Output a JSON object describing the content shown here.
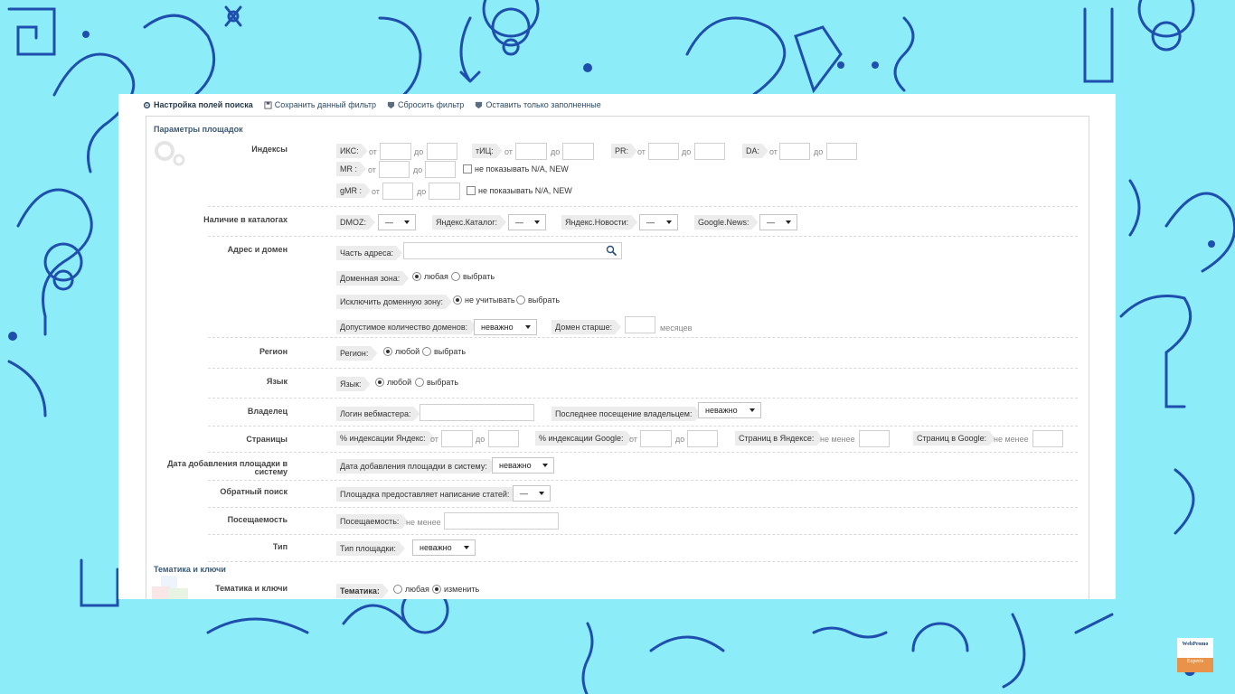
{
  "toolbar": {
    "items": [
      {
        "label": "Настройка полей поиска",
        "icon": "gear-icon"
      },
      {
        "label": "Сохранить данный фильтр",
        "icon": "save-icon"
      },
      {
        "label": "Сбросить фильтр",
        "icon": "shield-icon"
      },
      {
        "label": "Оставить только заполненные",
        "icon": "shield-icon"
      }
    ]
  },
  "sections": {
    "params_title": "Параметры площадок",
    "topics_title": "Тематика и ключи"
  },
  "indexes": {
    "label": "Индексы",
    "iks": "ИКС:",
    "tic": "тИЦ:",
    "pr": "PR:",
    "da": "DA:",
    "mr": "MR :",
    "gmr": "gMR :",
    "from": "от",
    "to": "до",
    "hide_na": "не показывать N/A, NEW"
  },
  "catalogs": {
    "label": "Наличие в каталогах",
    "dmoz": "DMOZ:",
    "yandex_catalog": "Яндекс.Каталог:",
    "yandex_news": "Яндекс.Новости:",
    "google_news": "Google.News:",
    "dash": "—"
  },
  "address": {
    "label": "Адрес и домен",
    "part": "Часть адреса:",
    "zone": "Доменная зона:",
    "exclude_zone": "Исключить доменную зону:",
    "domains_count": "Допустимое количество доменов:",
    "domains_count_value": "неважно",
    "domain_older": "Домен старше:",
    "months": "месяцев",
    "any": "любая",
    "choose": "выбрать",
    "ignore": "не учитывать"
  },
  "region": {
    "label": "Регион",
    "field": "Регион:",
    "any": "любой",
    "choose": "выбрать"
  },
  "language": {
    "label": "Язык",
    "field": "Язык:",
    "any": "любой",
    "choose": "выбрать"
  },
  "owner": {
    "label": "Владелец",
    "login": "Логин вебмастера:",
    "last_visit": "Последнее посещение владельцем:",
    "last_visit_value": "неважно"
  },
  "pages": {
    "label": "Страницы",
    "yandex_idx": "% индексации Яндекс:",
    "google_idx": "% индексации Google:",
    "yandex_pages": "Страниц в Яндексе:",
    "google_pages": "Страниц в Google:",
    "from": "от",
    "to": "до",
    "min": "не менее"
  },
  "date_added": {
    "label": "Дата добавления площадки в систему",
    "field": "Дата добавления площадки в систему:",
    "value": "неважно"
  },
  "reverse": {
    "label": "Обратный поиск",
    "field": "Площадка предоставляет написание статей:",
    "value": "—"
  },
  "traffic": {
    "label": "Посещаемость",
    "field": "Посещаемость:",
    "min": "не менее"
  },
  "type": {
    "label": "Тип",
    "field": "Тип площадки:",
    "value": "неважно"
  },
  "topics": {
    "label": "Тематика и ключи",
    "field": "Тематика:",
    "any": "любая",
    "change": "изменить"
  },
  "logo": {
    "line1": "WebPromo",
    "line2": "Experts"
  },
  "colors": {
    "background": "#8cecf7",
    "doodle": "#1f4fae",
    "panel": "#ffffff",
    "logo_accent": "#e8924a"
  }
}
